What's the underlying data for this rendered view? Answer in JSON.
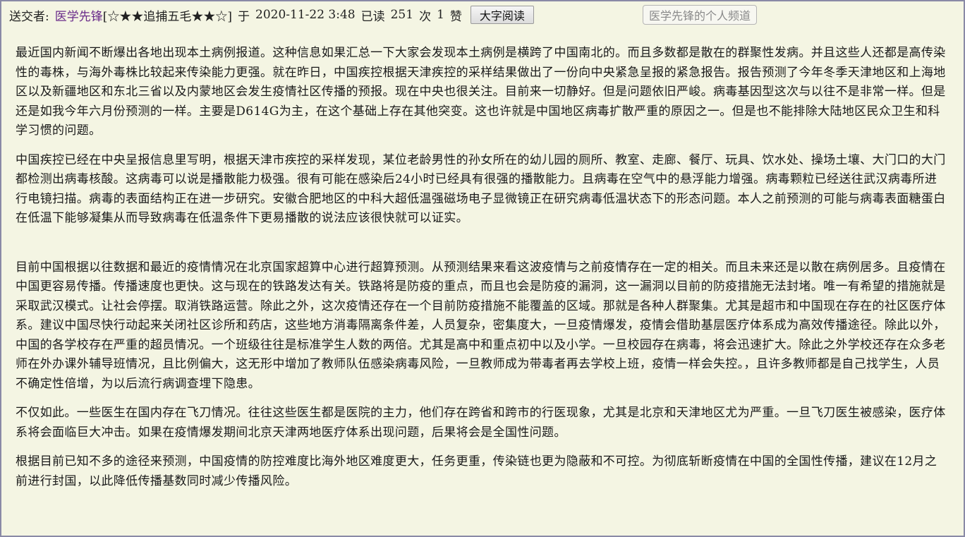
{
  "header": {
    "sender_label": "送交者:",
    "author": "医学先锋",
    "badge": "[☆★★追捕五毛★★☆]",
    "at_label": "于",
    "datetime": "2020-11-22 3:48",
    "read_label": "已读",
    "read_count": "251",
    "times_label": "次",
    "likes": "1",
    "likes_label": "赞",
    "large_text_button": "大字阅读",
    "channel_button": "医学先锋的个人频道"
  },
  "article": {
    "paragraphs": [
      "最近国内新闻不断爆出各地出现本土病例报道。这种信息如果汇总一下大家会发现本土病例是横跨了中国南北的。而且多数都是散在的群聚性发病。并且这些人还都是高传染性的毒株，与海外毒株比较起来传染能力更强。就在昨日，中国疾控根据天津疾控的采样结果做出了一份向中央紧急呈报的紧急报告。报告预测了今年冬季天津地区和上海地区以及新疆地区和东北三省以及内蒙地区会发生疫情社区传播的预报。现在中央也很关注。目前来一切静好。但是问题依旧严峻。病毒基因型这次与以往不是非常一样。但是还是如我今年六月份预测的一样。主要是D614G为主，在这个基础上存在其他突变。这也许就是中国地区病毒扩散严重的原因之一。但是也不能排除大陆地区民众卫生和科学习惯的问题。",
      "中国疾控已经在中央呈报信息里写明，根据天津市疾控的采样发现，某位老龄男性的孙女所在的幼儿园的厕所、教室、走廊、餐厅、玩具、饮水处、操场土壤、大门口的大门都检测出病毒核酸。这病毒可以说是播散能力极强。很有可能在感染后24小时已经具有很强的播散能力。且病毒在空气中的悬浮能力增强。病毒颗粒已经送往武汉病毒所进行电镜扫描。病毒的表面结构正在进一步研究。安徽合肥地区的中科大超低温强磁场电子显微镜正在研究病毒低温状态下的形态问题。本人之前预测的可能与病毒表面糖蛋白在低温下能够凝集从而导致病毒在低温条件下更易播散的说法应该很快就可以证实。",
      "目前中国根据以往数据和最近的疫情情况在北京国家超算中心进行超算预测。从预测结果来看这波疫情与之前疫情存在一定的相关。而且未来还是以散在病例居多。且疫情在中国更容易传播。传播速度也更快。这与现在的铁路发达有关。铁路将是防疫的重点，而且也会是防疫的漏洞，这一漏洞以目前的防疫措施无法封堵。唯一有希望的措施就是采取武汉模式。让社会停摆。取消铁路运营。除此之外，这次疫情还存在一个目前防疫措施不能覆盖的区域。那就是各种人群聚集。尤其是超市和中国现在存在的社区医疗体系。建议中国尽快行动起来关闭社区诊所和药店，这些地方消毒隔离条件差，人员复杂，密集度大，一旦疫情爆发，疫情会借助基层医疗体系成为高效传播途径。除此以外，中国的各学校存在严重的超员情况。一个班级往往是标准学生人数的两倍。尤其是高中和重点初中以及小学。一旦校园存在病毒，将会迅速扩大。除此之外学校还存在众多老师在外办课外辅导班情况，且比例偏大，这无形中增加了教师队伍感染病毒风险，一旦教师成为带毒者再去学校上班，疫情一样会失控。，且许多教师都是自己找学生，人员不确定性倍增，为以后流行病调查埋下隐患。",
      "不仅如此。一些医生在国内存在飞刀情况。往往这些医生都是医院的主力，他们存在跨省和跨市的行医现象，尤其是北京和天津地区尤为严重。一旦飞刀医生被感染，医疗体系将会面临巨大冲击。如果在疫情爆发期间北京天津两地医疗体系出现问题，后果将会是全国性问题。",
      "根据目前已知不多的途径来预测，中国疫情的防控难度比海外地区难度更大，任务更重，传染链也更为隐蔽和不可控。为彻底斩断疫情在中国的全国性传播，建议在12月之前进行封国，以此降低传播基数同时减少传播风险。"
    ]
  }
}
